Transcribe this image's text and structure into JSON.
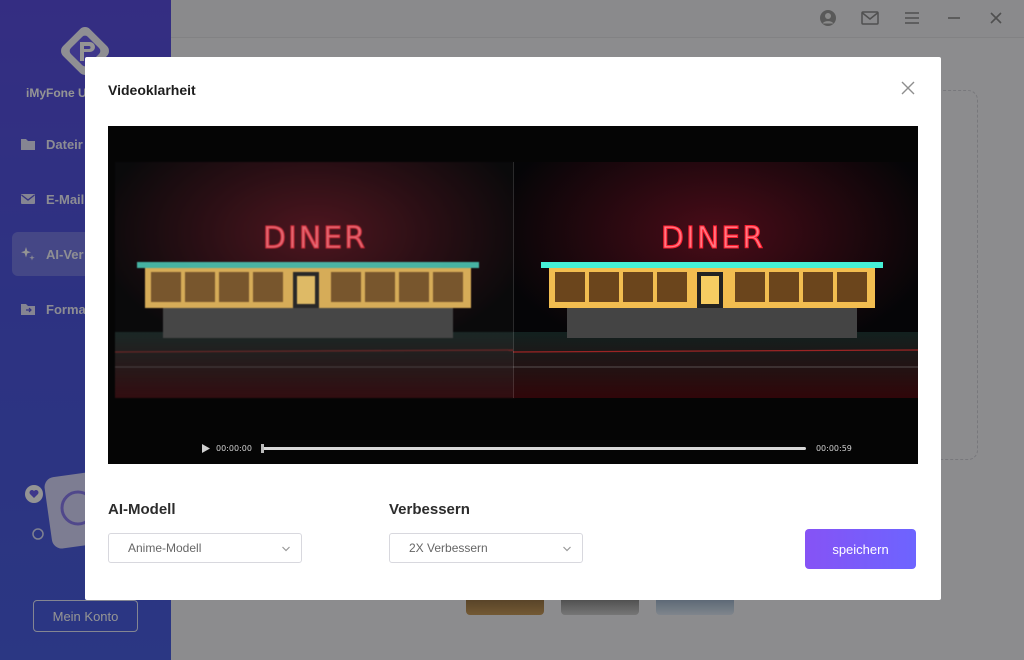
{
  "app": {
    "brand": "iMyFone U",
    "nav": [
      {
        "label": "Dateir",
        "icon": "folder-icon"
      },
      {
        "label": "E-Mail",
        "icon": "mail-icon"
      },
      {
        "label": "AI-Ver",
        "icon": "ai-sparkle-icon",
        "active": true
      },
      {
        "label": "Forma",
        "icon": "format-icon"
      }
    ],
    "account_button": "Mein Konto",
    "window_icons": [
      "user-icon",
      "mail-icon",
      "menu-icon",
      "minimize-icon",
      "close-icon"
    ]
  },
  "modal": {
    "title": "Videoklarheit",
    "video": {
      "sign_text": "DINER",
      "time_current": "00:00:00",
      "time_total": "00:00:59",
      "progress": 0.0
    },
    "ai_model": {
      "label": "AI-Modell",
      "value": "Anime-Modell"
    },
    "enhance": {
      "label": "Verbessern",
      "value": "2X Verbessern"
    },
    "save_label": "speichern"
  },
  "colors": {
    "accent": "#7b5cf8",
    "sidebar": "#5254e0",
    "neon_red": "#ff2a3a",
    "neon_teal": "#3fe0c8"
  }
}
